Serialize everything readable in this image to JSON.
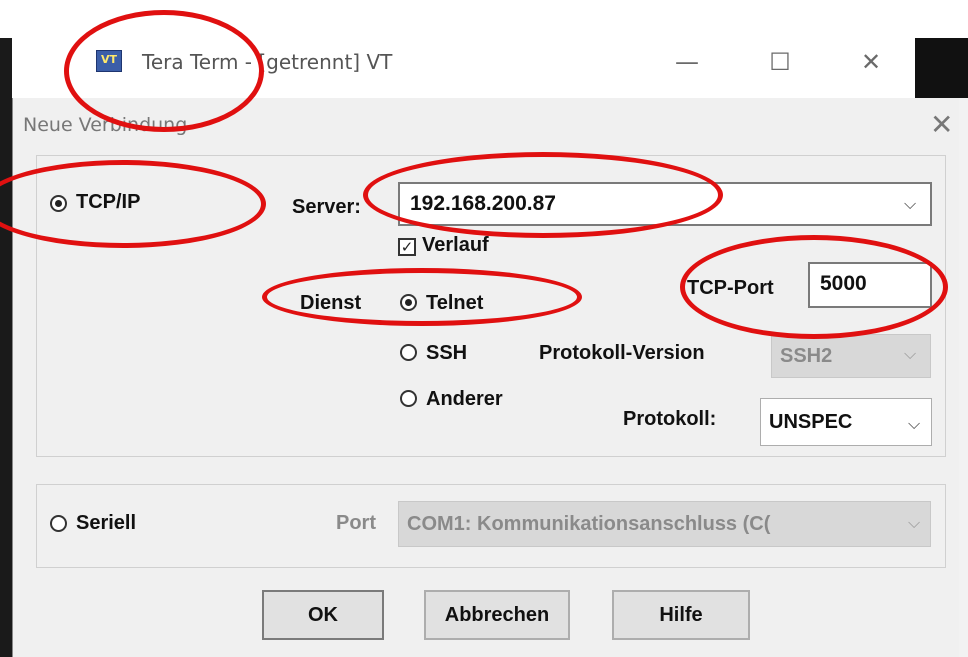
{
  "main_window": {
    "title": "Tera Term - [getrennt] VT",
    "icon_text": "VT",
    "minimize": "—",
    "maximize": "☐",
    "close": "✕"
  },
  "dialog": {
    "title": "Neue Verbindung",
    "close": "✕",
    "tcpip": {
      "label": "TCP/IP",
      "selected": true,
      "server_label": "Server:",
      "server_value": "192.168.200.87",
      "history_label": "Verlauf",
      "history_checked": true,
      "service_label": "Dienst",
      "services": [
        {
          "label": "Telnet",
          "selected": true
        },
        {
          "label": "SSH",
          "selected": false
        },
        {
          "label": "Anderer",
          "selected": false
        }
      ],
      "tcp_port_label": "TCP-Port",
      "tcp_port_value": "5000",
      "protocol_version_label": "Protokoll-Version",
      "protocol_version_value": "SSH2",
      "protocol_label": "Protokoll:",
      "protocol_value": "UNSPEC"
    },
    "serial": {
      "label": "Seriell",
      "selected": false,
      "port_label": "Port",
      "port_value": "COM1: Kommunikationsanschluss (C("
    },
    "buttons": {
      "ok": "OK",
      "cancel": "Abbrechen",
      "help": "Hilfe"
    }
  },
  "annotation_color": "#e01010"
}
